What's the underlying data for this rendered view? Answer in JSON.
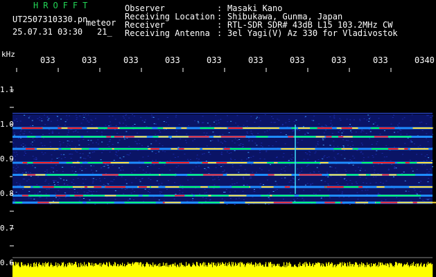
{
  "header": {
    "app_name": "HROFFT",
    "file_name": "UT2507310330.pn",
    "file_suffix": "meteor",
    "date_time": "25.07.31 03:30",
    "date_extra": "21_"
  },
  "info": [
    {
      "label": "Observer",
      "value": "Masaki Kano"
    },
    {
      "label": "Receiving Location",
      "value": "Shibukawa, Gunma, Japan"
    },
    {
      "label": "Receiver",
      "value": "RTL-SDR SDR# 43dB L15 103.2MHz CW"
    },
    {
      "label": "Receiving Antenna",
      "value": "3el Yagi(V) Az 330 for Vladivostok"
    }
  ],
  "axis": {
    "freq_unit": "kHz",
    "time_labels": [
      "033",
      "033",
      "033",
      "033",
      "033",
      "033",
      "033",
      "033",
      "033",
      "0340"
    ],
    "freq_labels": [
      "1.1",
      "1.0",
      "0.9",
      "0.8",
      "0.7",
      "0.6"
    ]
  },
  "colors": {
    "background": "#000000",
    "spectrum_blue": "#1a2aa8",
    "signal_green": "#00ff66",
    "signal_red": "#ff2020",
    "amplitude_yellow": "#ffff00",
    "header_green": "#22d455"
  },
  "chart_data": {
    "type": "heatmap",
    "x_start": "03:30",
    "x_end": "03:40",
    "y_range_khz": [
      0.6,
      1.1
    ],
    "carrier_lines_khz": [
      0.99,
      0.965,
      0.93,
      0.89,
      0.855,
      0.82,
      0.795,
      0.775
    ],
    "spectrum_band_khz": [
      0.77,
      1.03
    ]
  }
}
